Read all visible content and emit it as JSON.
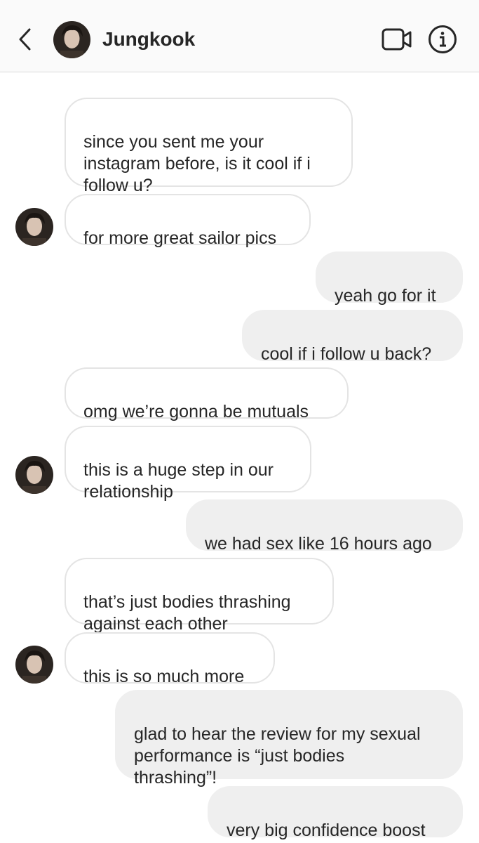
{
  "header": {
    "contact_name": "Jungkook",
    "back_icon": "chevron-left-icon",
    "video_icon": "video-camera-icon",
    "info_icon": "info-circle-icon"
  },
  "colors": {
    "header_bg": "#fafafa",
    "incoming_bubble_bg": "#ffffff",
    "incoming_bubble_border": "#e4e4e4",
    "outgoing_bubble_bg": "#efefef",
    "text": "#262626"
  },
  "messages": [
    {
      "sender": "them",
      "text": "since you sent me your\ninstagram before, is it cool if i\nfollow u?"
    },
    {
      "sender": "them",
      "text": "for more great sailor pics"
    },
    {
      "sender": "me",
      "text": "yeah go for it"
    },
    {
      "sender": "me",
      "text": "cool if i follow u back?"
    },
    {
      "sender": "them",
      "text": "omg we’re gonna be mutuals"
    },
    {
      "sender": "them",
      "text": "this is a huge step in our\nrelationship"
    },
    {
      "sender": "me",
      "text": "we had sex like 16 hours ago"
    },
    {
      "sender": "them",
      "text": "that’s just bodies thrashing\nagainst each other"
    },
    {
      "sender": "them",
      "text": "this is so much more"
    },
    {
      "sender": "me",
      "text": "glad to hear the review for my sexual\nperformance is “just bodies\nthrashing”!"
    },
    {
      "sender": "me",
      "text": "very big confidence boost"
    }
  ]
}
